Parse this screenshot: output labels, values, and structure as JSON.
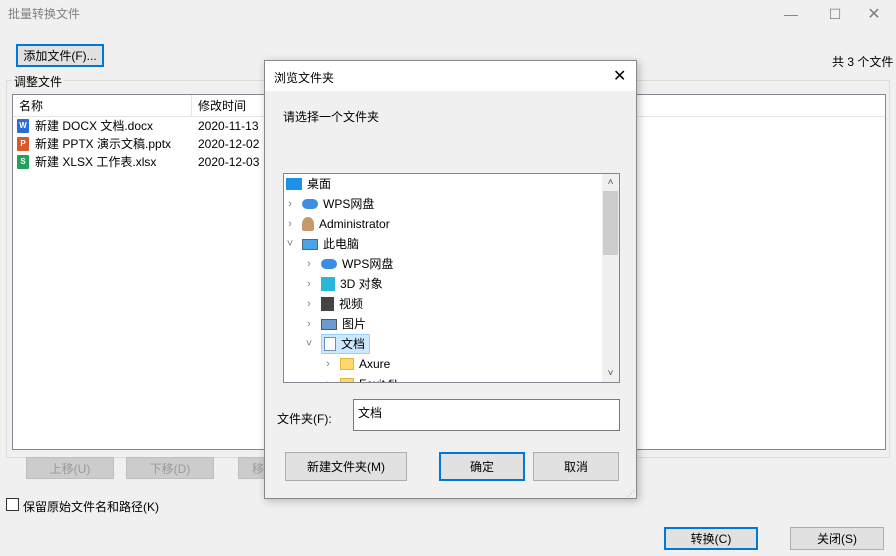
{
  "window": {
    "title": "批量转换文件",
    "add_button": "添加文件(F)...",
    "count": "共 3 个文件",
    "group_label": "调整文件",
    "columns": [
      "名称",
      "修改时间"
    ],
    "files": [
      {
        "name": "新建 DOCX 文档.docx",
        "date": "2020-11-13",
        "icon_color": "#2b6cd8",
        "icon_letter": "W"
      },
      {
        "name": "新建 PPTX 演示文稿.pptx",
        "date": "2020-12-02",
        "icon_color": "#d65a2a",
        "icon_letter": "P"
      },
      {
        "name": "新建 XLSX 工作表.xlsx",
        "date": "2020-12-03",
        "icon_color": "#22a05a",
        "icon_letter": "S"
      }
    ],
    "move_up": "上移(U)",
    "move_down": "下移(D)",
    "third_partial": "移",
    "keep_path_label": "保留原始文件名和路径(K)",
    "convert_button": "转换(C)",
    "close_button": "关闭(S)"
  },
  "dialog": {
    "title": "浏览文件夹",
    "prompt": "请选择一个文件夹",
    "tree": [
      {
        "label": "桌面",
        "icon": "desktop-icon",
        "chevron": ""
      },
      {
        "label": "WPS网盘",
        "icon": "cloud-icon",
        "chevron": ">"
      },
      {
        "label": "Administrator",
        "icon": "user-icon",
        "chevron": ">"
      },
      {
        "label": "此电脑",
        "icon": "computer-icon",
        "chevron": "v"
      },
      {
        "label": "WPS网盘",
        "icon": "cloud-icon",
        "chevron": ">"
      },
      {
        "label": "3D 对象",
        "icon": "cube-icon",
        "chevron": ">"
      },
      {
        "label": "视频",
        "icon": "video-icon",
        "chevron": ">"
      },
      {
        "label": "图片",
        "icon": "picture-icon",
        "chevron": ">"
      },
      {
        "label": "文档",
        "icon": "document-icon",
        "chevron": "v"
      },
      {
        "label": "Axure",
        "icon": "folder-icon",
        "chevron": ">"
      },
      {
        "label": "Foxit fil",
        "icon": "folder-icon",
        "chevron": ">"
      }
    ],
    "folder_label": "文件夹(F):",
    "folder_value": "文档",
    "new_folder_button": "新建文件夹(M)",
    "ok_button": "确定",
    "cancel_button": "取消"
  }
}
